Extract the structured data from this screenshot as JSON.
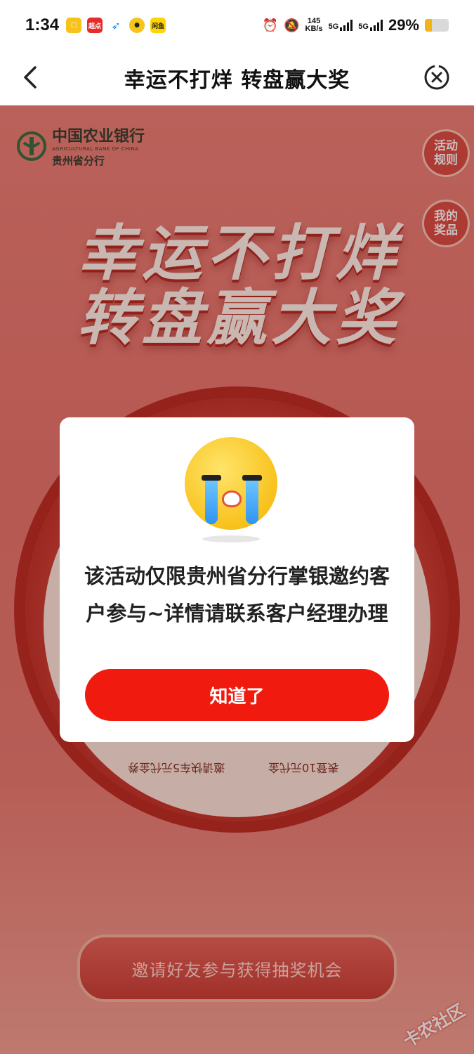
{
  "status_bar": {
    "time": "1:34",
    "notif_icons": [
      {
        "name": "app-icon-copy",
        "label": "",
        "color": "#f7c21a"
      },
      {
        "name": "app-icon-chaodian",
        "label": "超点",
        "color": "#e52b2b"
      },
      {
        "name": "app-icon-bird",
        "label": "",
        "color": "#1e88e5"
      },
      {
        "name": "app-icon-duck",
        "label": "",
        "color": "#f5c518"
      },
      {
        "name": "app-icon-xianyu",
        "label": "闲鱼",
        "color": "#ffd500"
      }
    ],
    "net_speed": "145",
    "net_unit": "KB/s",
    "sig1_label": "5G",
    "sig2_label": "5G",
    "battery_pct_text": "29%",
    "battery_level": 0.29
  },
  "nav": {
    "title": "幸运不打烊 转盘赢大奖"
  },
  "page": {
    "bank_name": "中国农业银行",
    "bank_en": "AGRICULTURAL BANK OF CHINA",
    "bank_branch": "贵州省分行",
    "rules_label": "活动\n规则",
    "prizes_label": "我的\n奖品",
    "hero_line1": "幸运不打烊",
    "hero_line2": "转盘赢大奖",
    "wheel_seg_left": "邀请快车5元代金券",
    "wheel_seg_right": "表登10元代金",
    "invite_label": "邀请好友参与获得抽奖机会",
    "watermark": "卡农社区"
  },
  "dialog": {
    "message": "该活动仅限贵州省分行掌银邀约客户参与~详情请联系客户经理办理",
    "confirm_label": "知道了"
  },
  "colors": {
    "accent": "#f01b0e",
    "page_bg": "#e5736a"
  }
}
